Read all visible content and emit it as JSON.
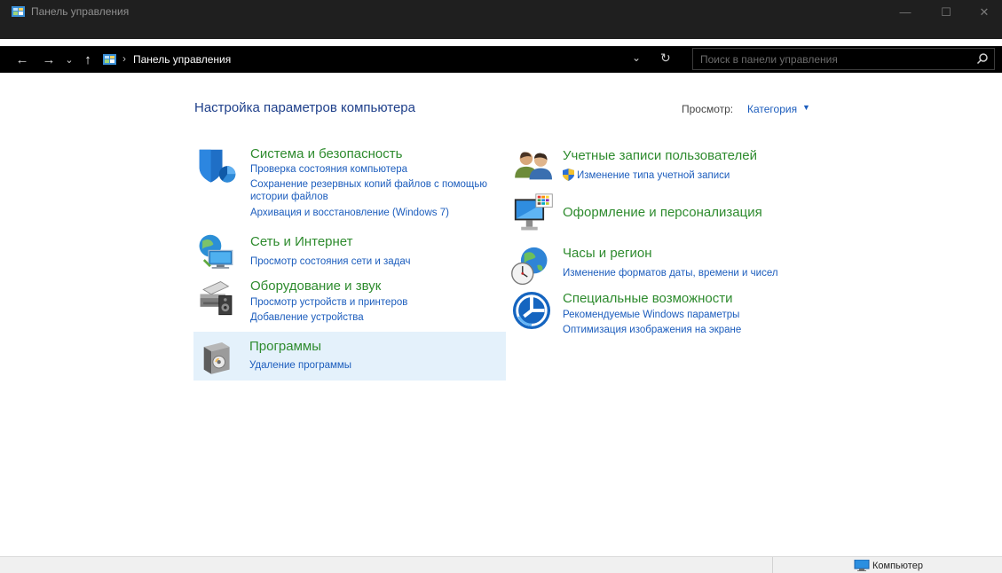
{
  "window": {
    "title": "Панель управления",
    "minimize": "—",
    "maximize": "☐",
    "close": "✕"
  },
  "nav": {
    "back": "←",
    "forward": "→",
    "recent": "⌄",
    "up": "↑",
    "separator": "›",
    "address": "Панель управления",
    "dropdown": "⌄",
    "refresh": "↻",
    "search_placeholder": "Поиск в панели управления"
  },
  "main": {
    "title": "Настройка параметров компьютера",
    "view_label": "Просмотр:",
    "view_value": "Категория",
    "view_caret": "▼"
  },
  "categories": {
    "system": {
      "title": "Система и безопасность",
      "links": [
        "Проверка состояния компьютера",
        "Сохранение резервных копий файлов с помощью",
        "истории файлов",
        "Архивация и восстановление (Windows 7)"
      ]
    },
    "network": {
      "title": "Сеть и Интернет",
      "links": [
        "Просмотр состояния сети и задач"
      ]
    },
    "hardware": {
      "title": "Оборудование и звук",
      "links": [
        "Просмотр устройств и принтеров",
        "Добавление устройства"
      ]
    },
    "programs": {
      "title": "Программы",
      "links": [
        "Удаление программы"
      ]
    },
    "accounts": {
      "title": "Учетные записи пользователей",
      "links": [
        "Изменение типа учетной записи"
      ]
    },
    "appearance": {
      "title": "Оформление и персонализация",
      "links": []
    },
    "clock": {
      "title": "Часы и регион",
      "links": [
        "Изменение форматов даты, времени и чисел"
      ]
    },
    "access": {
      "title": "Специальные возможности",
      "links": [
        "Рекомендуемые Windows параметры",
        "Оптимизация изображения на экране"
      ]
    }
  },
  "status": {
    "location": "Компьютер"
  }
}
